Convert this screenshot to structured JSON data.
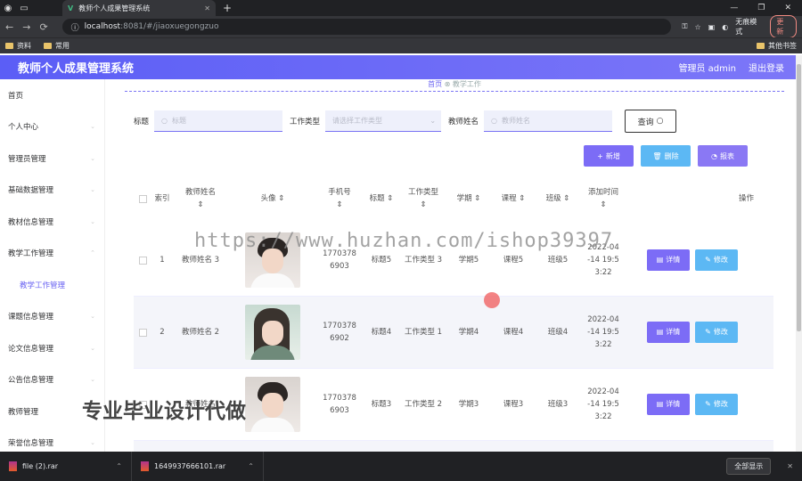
{
  "browser": {
    "tab_title": "教师个人成果管理系统",
    "url_host": "localhost",
    "url_path": ":8081/#/jiaoxuegongzuo",
    "incognito_label": "无痕模式",
    "update_label": "更新",
    "bookmarks": [
      "资料",
      "常用"
    ],
    "other_bookmarks": "其他书签"
  },
  "app": {
    "title": "教师个人成果管理系统",
    "user_label": "管理员 admin",
    "logout_label": "退出登录"
  },
  "sidebar": {
    "items": [
      {
        "label": "首页",
        "sub": false
      },
      {
        "label": "个人中心",
        "sub": false
      },
      {
        "label": "管理员管理",
        "sub": false
      },
      {
        "label": "基础数据管理",
        "sub": false
      },
      {
        "label": "教材信息管理",
        "sub": false
      },
      {
        "label": "教学工作管理",
        "sub": false
      },
      {
        "label": "教学工作管理",
        "sub": true
      },
      {
        "label": "课题信息管理",
        "sub": false
      },
      {
        "label": "论文信息管理",
        "sub": false
      },
      {
        "label": "公告信息管理",
        "sub": false
      },
      {
        "label": "教师管理",
        "sub": false
      },
      {
        "label": "荣誉信息管理",
        "sub": false
      }
    ]
  },
  "breadcrumb": {
    "home": "首页",
    "current": "教学工作"
  },
  "search": {
    "title_label": "标题",
    "title_placeholder": "标题",
    "type_label": "工作类型",
    "type_placeholder": "请选择工作类型",
    "teacher_label": "教师姓名",
    "teacher_placeholder": "教师姓名",
    "query_label": "查询"
  },
  "actions": {
    "add": "新增",
    "delete": "删除",
    "report": "报表"
  },
  "table": {
    "headers": [
      "索引",
      "教师姓名",
      "头像",
      "手机号",
      "标题",
      "工作类型",
      "学期",
      "课程",
      "班级",
      "添加时间",
      "操作"
    ],
    "rows": [
      {
        "index": "1",
        "name": "教师姓名 3",
        "phone": "1770378 6903",
        "title": "标题5",
        "type": "工作类型 3",
        "term": "学期5",
        "course": "课程5",
        "class": "班级5",
        "time": "2022-04 -14 19:5 3:22"
      },
      {
        "index": "2",
        "name": "教师姓名 2",
        "phone": "1770378 6902",
        "title": "标题4",
        "type": "工作类型 1",
        "term": "学期4",
        "course": "课程4",
        "class": "班级4",
        "time": "2022-04 -14 19:5 3:22"
      },
      {
        "index": "",
        "name": "教师姓名",
        "phone": "1770378 6903",
        "title": "标题3",
        "type": "工作类型 2",
        "term": "学期3",
        "course": "课程3",
        "class": "班级3",
        "time": "2022-04 -14 19:5 3:22"
      }
    ],
    "detail_label": "详情",
    "edit_label": "修改"
  },
  "watermark": {
    "url": "https://www.huzhan.com/ishop39397",
    "slogan": "专业毕业设计代做"
  },
  "downloads": {
    "items": [
      "file (2).rar",
      "1649937666101.rar"
    ],
    "show_all": "全部显示"
  }
}
